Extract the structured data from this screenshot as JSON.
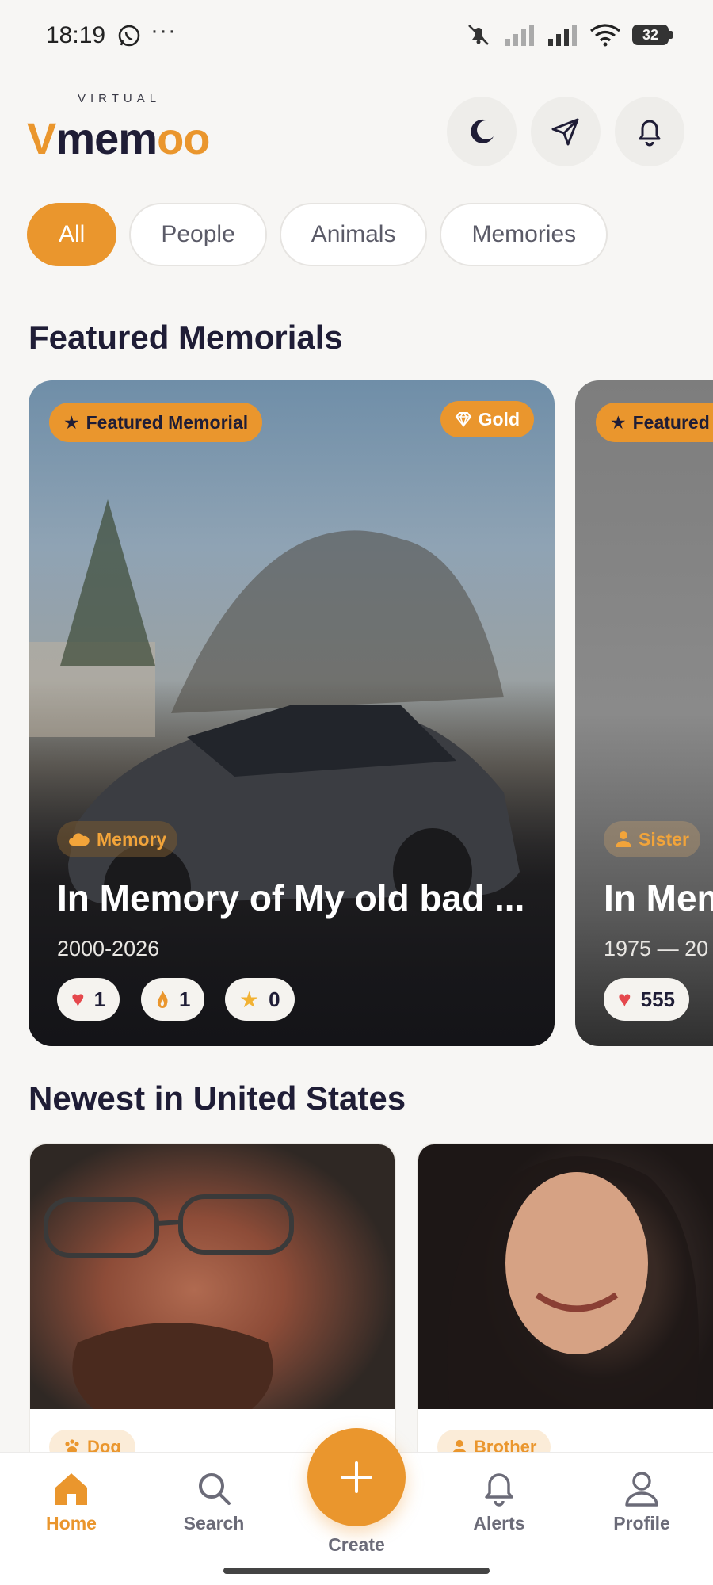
{
  "status_bar": {
    "time": "18:19",
    "battery": "32"
  },
  "header": {
    "brand_small": "VIRTUAL",
    "brand_v": "V",
    "brand_mem": "mem",
    "brand_oo": "oo"
  },
  "filters": [
    {
      "label": "All",
      "active": true
    },
    {
      "label": "People",
      "active": false
    },
    {
      "label": "Animals",
      "active": false
    },
    {
      "label": "Memories",
      "active": false
    }
  ],
  "featured": {
    "section_title": "Featured Memorials",
    "cards": [
      {
        "badge": "Featured Memorial",
        "tier": "Gold",
        "category": "Memory",
        "title": "In Memory of My old bad ...",
        "dates": "2000-2026",
        "reactions": {
          "hearts": "1",
          "candles": "1",
          "stars": "0"
        }
      },
      {
        "badge": "Featured",
        "category": "Sister",
        "title": "In Mem",
        "dates": "1975 — 20",
        "reactions": {
          "hearts": "555"
        }
      }
    ]
  },
  "newest": {
    "section_title": "Newest in United States",
    "cards": [
      {
        "tag": "Dog"
      },
      {
        "tag": "Brother"
      }
    ]
  },
  "nav": {
    "home": "Home",
    "search": "Search",
    "create": "Create",
    "alerts": "Alerts",
    "profile": "Profile"
  },
  "colors": {
    "accent": "#ea962d",
    "dark": "#1f1d36",
    "background": "#f7f6f4"
  }
}
